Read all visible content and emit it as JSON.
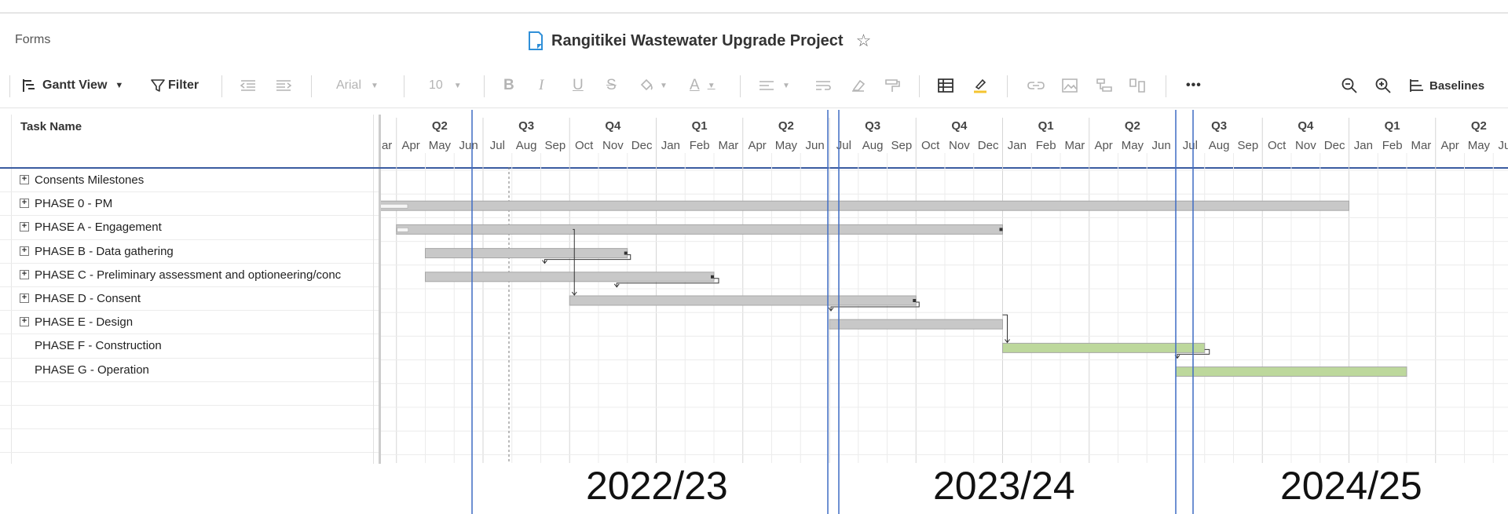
{
  "app": {
    "forms_label": "Forms",
    "title": "Rangitikei Wastewater Upgrade Project"
  },
  "toolbar": {
    "view_label": "Gantt View",
    "filter_label": "Filter",
    "font_name": "Arial",
    "font_size": "10",
    "more_label": "•••",
    "baselines_label": "Baselines"
  },
  "grid": {
    "task_name_header": "Task Name",
    "rows": [
      {
        "label": "Consents Milestones",
        "expandable": true
      },
      {
        "label": "PHASE 0 - PM",
        "expandable": true
      },
      {
        "label": "PHASE A - Engagement",
        "expandable": true
      },
      {
        "label": "PHASE B - Data gathering",
        "expandable": true
      },
      {
        "label": "PHASE C - Preliminary assessment and optioneering/conc",
        "expandable": true
      },
      {
        "label": "PHASE D - Consent",
        "expandable": true
      },
      {
        "label": "PHASE E - Design",
        "expandable": true
      },
      {
        "label": "PHASE F - Construction",
        "expandable": false
      },
      {
        "label": "PHASE G - Operation",
        "expandable": false
      }
    ]
  },
  "timeline": {
    "quarters": [
      "Q2",
      "Q3",
      "Q4",
      "Q1",
      "Q2",
      "Q3",
      "Q4",
      "Q1",
      "Q2",
      "Q3",
      "Q4",
      "Q1",
      "Q2"
    ],
    "months": [
      "Mar",
      "Apr",
      "May",
      "Jun",
      "Jul",
      "Aug",
      "Sep",
      "Oct",
      "Nov",
      "Dec",
      "Jan",
      "Feb",
      "Mar",
      "Apr",
      "May",
      "Jun",
      "Jul",
      "Aug",
      "Sep",
      "Oct",
      "Nov",
      "Dec",
      "Jan",
      "Feb",
      "Mar",
      "Apr",
      "May",
      "Jun",
      "Jul",
      "Aug",
      "Sep",
      "Oct",
      "Nov",
      "Dec",
      "Jan",
      "Feb",
      "Mar",
      "Apr",
      "May",
      "Jun"
    ],
    "bars": [
      {
        "row": 1,
        "start": "2022-03",
        "end": "2024-12",
        "color": "#c8c8c8"
      },
      {
        "row": 2,
        "start": "2022-04",
        "end": "2023-12",
        "color": "#c8c8c8"
      },
      {
        "row": 3,
        "start": "2022-05",
        "end": "2022-11",
        "color": "#c8c8c8"
      },
      {
        "row": 4,
        "start": "2022-05",
        "end": "2023-02",
        "color": "#c8c8c8"
      },
      {
        "row": 5,
        "start": "2022-10",
        "end": "2023-09",
        "color": "#c8c8c8"
      },
      {
        "row": 6,
        "start": "2023-07",
        "end": "2023-12",
        "color": "#c8c8c8"
      },
      {
        "row": 7,
        "start": "2024-01",
        "end": "2024-07",
        "color": "#bdd89c"
      },
      {
        "row": 8,
        "start": "2024-07",
        "end": "2025-02",
        "color": "#bdd89c"
      }
    ]
  },
  "annotations": {
    "fiscal_years": [
      "2022/23",
      "2023/24",
      "2024/25"
    ],
    "box_color": "#3f6cc4"
  }
}
